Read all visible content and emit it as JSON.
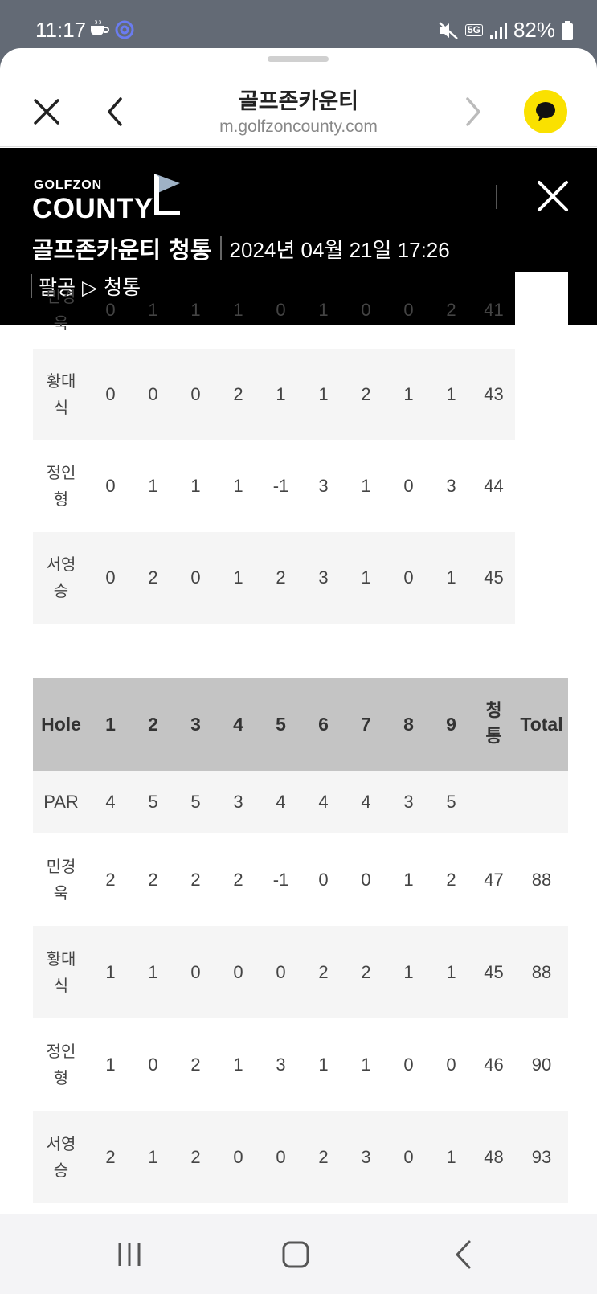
{
  "status": {
    "time": "11:17",
    "network": "5G",
    "battery": "82%"
  },
  "browser": {
    "title": "골프존카운티",
    "url": "m.golfzoncounty.com"
  },
  "header": {
    "logo_small": "GOLFZON",
    "logo_big": "COUNTY",
    "course": "골프존카운티 청통",
    "datetime": "2024년 04월 21일 17:26",
    "route": "팔공 ▷ 청통"
  },
  "table1": {
    "rows": [
      {
        "name": "민경욱",
        "scores": [
          "0",
          "1",
          "1",
          "1",
          "0",
          "1",
          "0",
          "0",
          "2"
        ],
        "sum": "41"
      },
      {
        "name": "황대식",
        "scores": [
          "0",
          "0",
          "0",
          "2",
          "1",
          "1",
          "2",
          "1",
          "1"
        ],
        "sum": "43"
      },
      {
        "name": "정인형",
        "scores": [
          "0",
          "1",
          "1",
          "1",
          "-1",
          "3",
          "1",
          "0",
          "3"
        ],
        "sum": "44"
      },
      {
        "name": "서영승",
        "scores": [
          "0",
          "2",
          "0",
          "1",
          "2",
          "3",
          "1",
          "0",
          "1"
        ],
        "sum": "45"
      }
    ]
  },
  "table2": {
    "header": {
      "hole": "Hole",
      "holes": [
        "1",
        "2",
        "3",
        "4",
        "5",
        "6",
        "7",
        "8",
        "9"
      ],
      "course": "청통",
      "total": "Total"
    },
    "par": {
      "label": "PAR",
      "values": [
        "4",
        "5",
        "5",
        "3",
        "4",
        "4",
        "4",
        "3",
        "5"
      ]
    },
    "rows": [
      {
        "name": "민경욱",
        "scores": [
          "2",
          "2",
          "2",
          "2",
          "-1",
          "0",
          "0",
          "1",
          "2"
        ],
        "sum": "47",
        "total": "88"
      },
      {
        "name": "황대식",
        "scores": [
          "1",
          "1",
          "0",
          "0",
          "0",
          "2",
          "2",
          "1",
          "1"
        ],
        "sum": "45",
        "total": "88"
      },
      {
        "name": "정인형",
        "scores": [
          "1",
          "0",
          "2",
          "1",
          "3",
          "1",
          "1",
          "0",
          "0"
        ],
        "sum": "46",
        "total": "90"
      },
      {
        "name": "서영승",
        "scores": [
          "2",
          "1",
          "2",
          "0",
          "0",
          "2",
          "3",
          "0",
          "1"
        ],
        "sum": "48",
        "total": "93"
      }
    ]
  }
}
